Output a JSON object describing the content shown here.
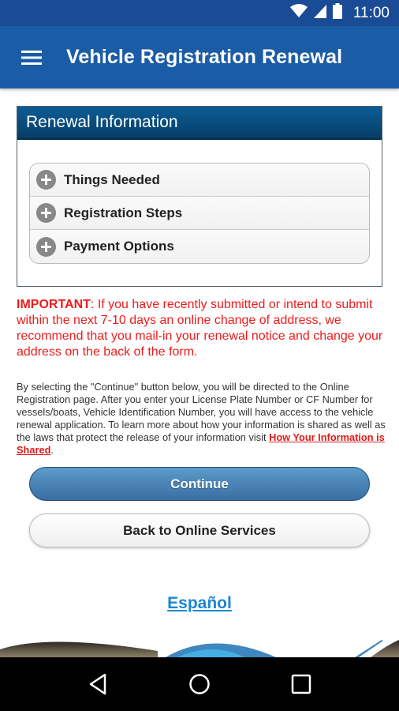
{
  "status_bar": {
    "time": "11:00",
    "icons": [
      "wifi-icon",
      "cell-signal-icon",
      "battery-icon"
    ]
  },
  "app_bar": {
    "menu_icon": "hamburger-menu-icon",
    "title": "Vehicle Registration Renewal"
  },
  "panel": {
    "title": "Renewal Information",
    "items": [
      {
        "label": "Things Needed",
        "icon": "plus-circle-icon"
      },
      {
        "label": "Registration Steps",
        "icon": "plus-circle-icon"
      },
      {
        "label": "Payment Options",
        "icon": "plus-circle-icon"
      }
    ]
  },
  "important": {
    "label": "IMPORTANT",
    "text": ": If you have recently submitted or intend to submit within the next 7-10 days an online change of address, we recommend that you mail-in your renewal notice and change your address on the back of the form."
  },
  "info": {
    "text": "By selecting the \"Continue\" button below, you will be directed to the Online Registration page. After you enter your License Plate Number or CF Number for vessels/boats, Vehicle Identification Number, you will have access to the vehicle renewal application. To learn more about how your information is shared as well as the laws that protect the release of your information visit ",
    "link_text": "How Your Information is Shared",
    "suffix": "."
  },
  "buttons": {
    "continue": "Continue",
    "back": "Back to Online Services"
  },
  "language_link": "Español",
  "nav_bar": {
    "icons": [
      "back-icon",
      "home-icon",
      "recents-icon"
    ]
  },
  "colors": {
    "status_bar": "#1a4c95",
    "app_bar": "#1b5ca6",
    "panel_header": "#0c5d96",
    "important_text": "#ee1b1b",
    "link": "#1a86d2"
  }
}
